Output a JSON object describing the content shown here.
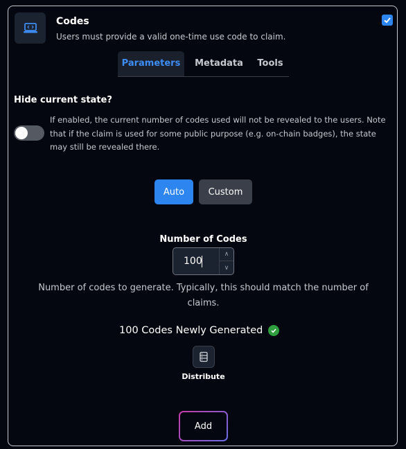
{
  "header": {
    "title": "Codes",
    "subtitle": "Users must provide a valid one-time use code to claim.",
    "enabled_checked": true,
    "icon": "code-laptop-icon"
  },
  "tabs": [
    {
      "label": "Parameters",
      "active": true
    },
    {
      "label": "Metadata",
      "active": false
    },
    {
      "label": "Tools",
      "active": false
    }
  ],
  "hide_state": {
    "label": "Hide current state?",
    "description": "If enabled, the current number of codes used will not be revealed to the users. Note that if the claim is used for some public purpose (e.g. on-chain badges), the state may still be revealed there.",
    "enabled": false
  },
  "mode": {
    "auto_label": "Auto",
    "custom_label": "Custom",
    "selected": "Auto"
  },
  "num_codes": {
    "label": "Number of Codes",
    "value": "100",
    "help": "Number of codes to generate. Typically, this should match the number of claims."
  },
  "generated": {
    "text": "100 Codes Newly Generated"
  },
  "distribute": {
    "label": "Distribute"
  },
  "add": {
    "label": "Add"
  },
  "colors": {
    "accent": "#2d86f0",
    "tab_active": "#3d8df5",
    "success": "#2e9e3e",
    "background": "#04070f"
  }
}
